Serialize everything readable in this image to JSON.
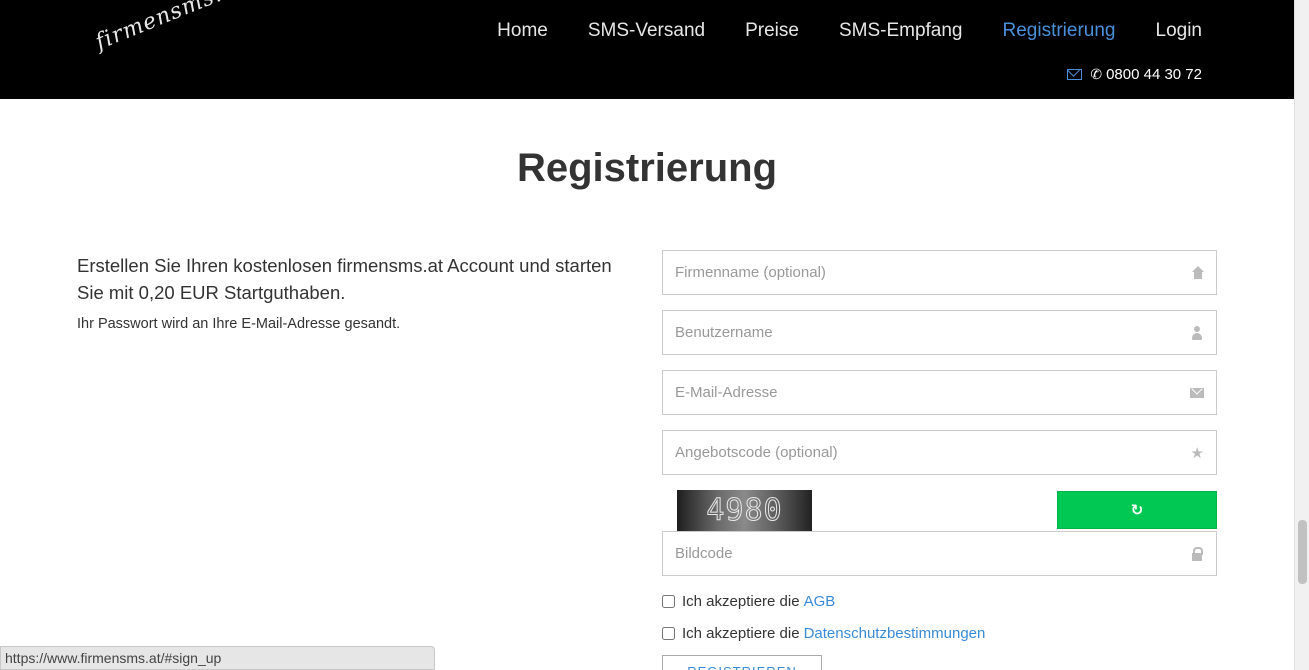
{
  "header": {
    "logo_text": "firmensms.at",
    "nav": [
      {
        "label": "Home"
      },
      {
        "label": "SMS-Versand"
      },
      {
        "label": "Preise"
      },
      {
        "label": "SMS-Empfang"
      },
      {
        "label": "Registrierung",
        "active": true
      },
      {
        "label": "Login"
      }
    ],
    "phone": "0800 44 30 72",
    "accent_color": "#4a90d9"
  },
  "main": {
    "title": "Registrierung",
    "intro": "Erstellen Sie Ihren kostenlosen firmensms.at Account und starten Sie mit 0,20 EUR Startguthaben.",
    "password_note": "Ihr Passwort wird an Ihre E-Mail-Adresse gesandt."
  },
  "form": {
    "company": {
      "placeholder": "Firmenname (optional)",
      "icon": "home-icon"
    },
    "username": {
      "placeholder": "Benutzername",
      "icon": "user-icon"
    },
    "email": {
      "placeholder": "E-Mail-Adresse",
      "icon": "envelope-icon"
    },
    "offer_code": {
      "placeholder": "Angebotscode (optional)",
      "icon": "star-icon"
    },
    "captcha_text": "4980",
    "captcha_code": {
      "placeholder": "Bildcode",
      "icon": "lock-icon"
    },
    "refresh_color": "#00c853",
    "agb": {
      "text": "Ich akzeptiere die",
      "link": "AGB"
    },
    "privacy": {
      "text": "Ich akzeptiere die",
      "link": "Datenschutzbestimmungen"
    },
    "submit_label": "REGISTRIEREN"
  },
  "status_bar": {
    "url": "https://www.firmensms.at/#sign_up"
  }
}
